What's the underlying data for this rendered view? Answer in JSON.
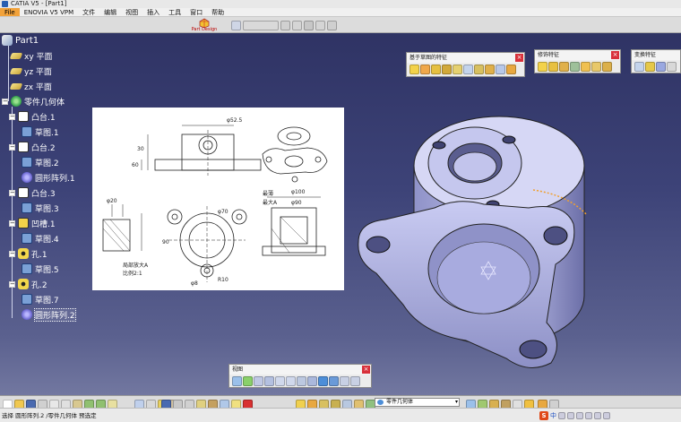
{
  "window": {
    "title": "CATIA V5 - [Part1]"
  },
  "menu": {
    "items": [
      "File",
      "ENOVIA V5 VPM",
      "文件",
      "编辑",
      "视图",
      "插入",
      "工具",
      "窗口",
      "帮助"
    ]
  },
  "workbench_logo": {
    "label": "Part Design"
  },
  "tree": {
    "root": "Part1",
    "planes": [
      "xy 平面",
      "yz 平面",
      "zx 平面"
    ],
    "body": "零件几何体",
    "features": [
      {
        "label": "凸台.1",
        "icon": "pad-icon",
        "sketch": "草图.1"
      },
      {
        "label": "凸台.2",
        "icon": "pad-icon",
        "sketch": "草图.2"
      },
      {
        "label": "圆形阵列.1",
        "icon": "pattern-icon"
      },
      {
        "label": "凸台.3",
        "icon": "pad-icon",
        "sketch": "草图.3"
      },
      {
        "label": "凹槽.1",
        "icon": "pocket-icon",
        "sketch": "草图.4"
      },
      {
        "label": "孔.1",
        "icon": "hole-icon",
        "sketch": "草图.5"
      },
      {
        "label": "孔.2",
        "icon": "hole-icon",
        "sketch": "草图.7"
      },
      {
        "label": "圆形阵列.2",
        "icon": "pattern-icon",
        "selected": true
      }
    ]
  },
  "toolbars": {
    "sketch_based": {
      "title": "基于草图的特征"
    },
    "dress_up": {
      "title": "修饰特征"
    },
    "transform": {
      "title": "变换特征"
    },
    "view": {
      "title": "视图"
    }
  },
  "drawing": {
    "dim_top": "φ52.5",
    "dim_height1": "30",
    "dim_height2": "60",
    "dim_right1": "φ100",
    "dim_right2": "φ90",
    "dim_left1": "φ20",
    "dim_center": "φ70",
    "dim_bottom": "R10",
    "dim_side": "90",
    "dim_note1": "最薄",
    "dim_note2": "最大A",
    "note_line1": "局部放大A",
    "note_line2": "比例2:1",
    "hole_label": "φ8"
  },
  "status": {
    "text": "选择 圆形阵列.2 /零件几何体 预选定",
    "dropdown_value": "零件几何体"
  },
  "ime": {
    "logo": "S",
    "label": "中"
  },
  "colors": {
    "background": "#3d4378",
    "menu_active": "#f2a23a",
    "model": "#b7b9ea",
    "close": "#d8303a"
  }
}
